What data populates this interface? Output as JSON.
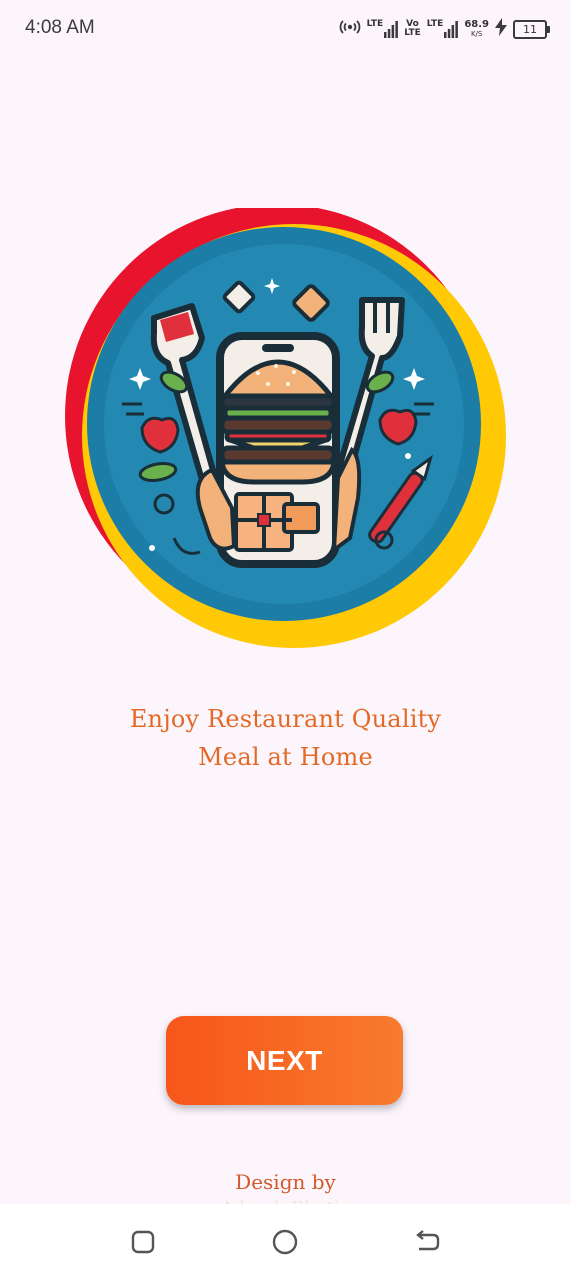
{
  "status_bar": {
    "time": "4:08 AM",
    "hotspot_icon": "hotspot-icon",
    "sim1_label": "LTE",
    "volte_top": "Vo",
    "volte_bottom": "LTE",
    "sim2_label": "LTE",
    "net_speed": "68.9",
    "net_speed_unit": "K/S",
    "charging_icon": "bolt-icon",
    "battery": "11"
  },
  "hero": {
    "illustration_icon": "food-delivery-illustration",
    "colors": {
      "red": "#e8142d",
      "yellow": "#ffc905",
      "blue": "#1c7da6"
    }
  },
  "onboarding": {
    "tagline_line1": "Enjoy Restaurant Quality",
    "tagline_line2": "Meal at Home",
    "next_label": "NEXT",
    "accent": "#f7561a"
  },
  "credit": {
    "label": "Design by",
    "name": "Adarsh Bhatia"
  },
  "nav": {
    "recents_icon": "square-icon",
    "home_icon": "circle-icon",
    "back_icon": "back-icon"
  }
}
